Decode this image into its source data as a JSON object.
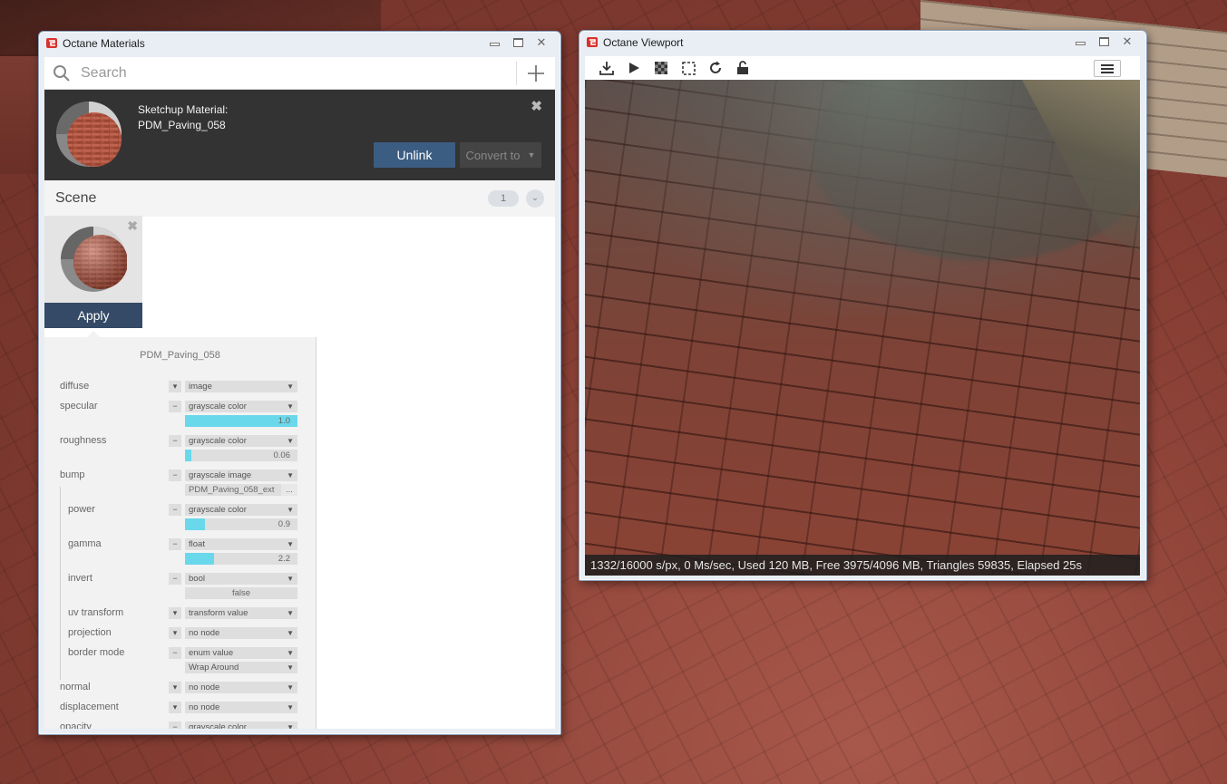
{
  "materials_window": {
    "title": "Octane Materials",
    "search": {
      "placeholder": "Search",
      "value": ""
    },
    "sketchup_material": {
      "label": "Sketchup Material:",
      "name": "PDM_Paving_058",
      "unlink_label": "Unlink",
      "convert_label": "Convert to"
    },
    "scene": {
      "label": "Scene",
      "count": "1",
      "apply_label": "Apply"
    },
    "properties": {
      "title": "PDM_Paving_058",
      "rows": [
        {
          "label": "diffuse",
          "btn": "▾",
          "type": "image"
        },
        {
          "label": "specular",
          "btn": "−",
          "type": "grayscale color",
          "value": "1.0",
          "level": 1.0
        },
        {
          "label": "roughness",
          "btn": "−",
          "type": "grayscale color",
          "value": "0.06",
          "level": 0.06
        },
        {
          "label": "bump",
          "btn": "−",
          "type": "grayscale image",
          "file": "PDM_Paving_058_ext",
          "file_dots": "..."
        },
        {
          "label": "power",
          "btn": "−",
          "type": "grayscale color",
          "value": "0.9",
          "level": 0.18
        },
        {
          "label": "gamma",
          "btn": "−",
          "type": "float",
          "value": "2.2",
          "level": 0.26
        },
        {
          "label": "invert",
          "btn": "−",
          "type": "bool",
          "value": "false"
        },
        {
          "label": "uv transform",
          "btn": "▾",
          "type": "transform value"
        },
        {
          "label": "projection",
          "btn": "▾",
          "type": "no node"
        },
        {
          "label": "border mode",
          "btn": "−",
          "type": "enum value",
          "sub": "Wrap Around"
        },
        {
          "label": "normal",
          "btn": "▾",
          "type": "no node"
        },
        {
          "label": "displacement",
          "btn": "▾",
          "type": "no node"
        },
        {
          "label": "opacity",
          "btn": "−",
          "type": "grayscale color"
        }
      ]
    }
  },
  "viewport_window": {
    "title": "Octane Viewport",
    "status": "1332/16000 s/px, 0 Ms/sec, Used 120 MB, Free 3975/4096 MB, Triangles 59835, Elapsed 25s"
  },
  "colors": {
    "accent_blue": "#3c5d82",
    "apply_blue": "#344a66",
    "slider_cyan": "#6ad8eb",
    "dark_panel": "#333333"
  },
  "icons": [
    "octane-logo-icon",
    "search-icon",
    "plus-icon",
    "close-icon",
    "download-icon",
    "play-icon",
    "checker-icon",
    "region-select-icon",
    "refresh-icon",
    "unlock-icon",
    "hamburger-menu-icon"
  ]
}
